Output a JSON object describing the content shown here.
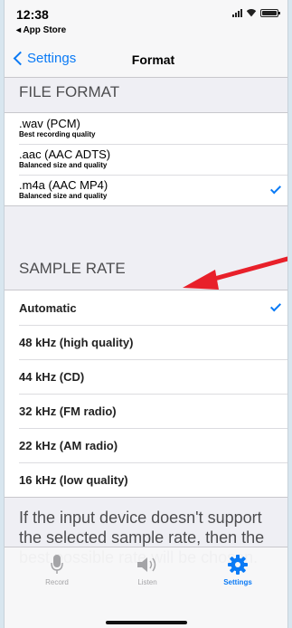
{
  "status_bar": {
    "time": "12:38",
    "back_app": "App Store"
  },
  "nav": {
    "back_label": "Settings",
    "title": "Format"
  },
  "file_format": {
    "header": "FILE FORMAT",
    "items": [
      {
        "title": ".wav (PCM)",
        "subtitle": "Best recording quality",
        "selected": false
      },
      {
        "title": ".aac (AAC ADTS)",
        "subtitle": "Balanced size and quality",
        "selected": false
      },
      {
        "title": ".m4a (AAC MP4)",
        "subtitle": "Balanced size and quality",
        "selected": true
      }
    ]
  },
  "sample_rate": {
    "header": "SAMPLE RATE",
    "items": [
      {
        "label": "Automatic",
        "selected": true
      },
      {
        "label": "48 kHz (high quality)",
        "selected": false
      },
      {
        "label": "44 kHz (CD)",
        "selected": false
      },
      {
        "label": "32 kHz (FM radio)",
        "selected": false
      },
      {
        "label": "22 kHz (AM radio)",
        "selected": false
      },
      {
        "label": "16 kHz (low quality)",
        "selected": false
      }
    ]
  },
  "footer_text": "If the input device doesn't support the selected sample rate, then the best possible rate will be chosen.",
  "tabs": [
    {
      "label": "Record",
      "icon": "microphone-icon",
      "active": false
    },
    {
      "label": "Listen",
      "icon": "speaker-icon",
      "active": false
    },
    {
      "label": "Settings",
      "icon": "gear-icon",
      "active": true
    }
  ],
  "colors": {
    "accent": "#0a7af5",
    "annotation_arrow": "#e8202a"
  }
}
